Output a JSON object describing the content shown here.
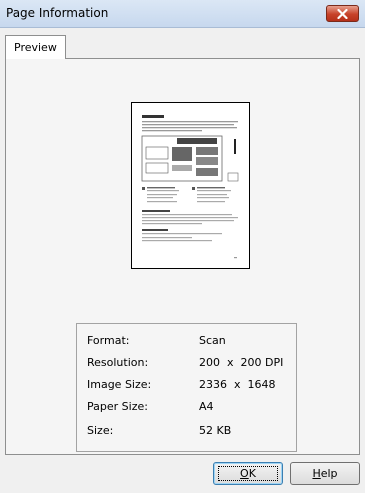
{
  "window": {
    "title": "Page Information"
  },
  "tabs": [
    {
      "label": "Preview"
    }
  ],
  "info": {
    "rows": [
      {
        "label": "Format:",
        "value": "Scan"
      },
      {
        "label": "Resolution:",
        "value": "200  x  200 DPI"
      },
      {
        "label": "Image Size:",
        "value": "2336  x  1648"
      },
      {
        "label": "Paper Size:",
        "value": "A4"
      },
      {
        "label": "Size:",
        "value": "52 KB"
      }
    ]
  },
  "buttons": {
    "ok": {
      "underline": "O",
      "rest": "K"
    },
    "help": {
      "underline": "H",
      "rest": "elp"
    }
  },
  "icons": {
    "close": "close-icon"
  },
  "colors": {
    "close_button": "#c7422a",
    "titlebar": "#dbe7f5",
    "panel_border": "#8e8f8f"
  }
}
